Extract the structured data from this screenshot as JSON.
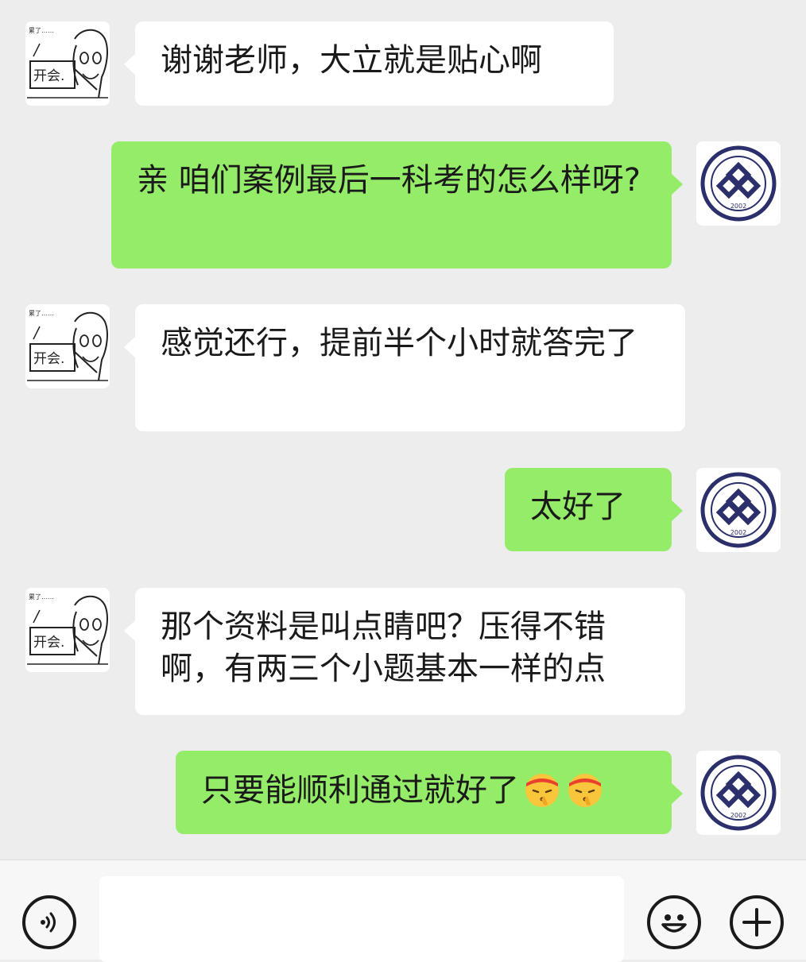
{
  "chat": {
    "messages": [
      {
        "sender": "contact",
        "text": "谢谢老师，大立就是贴心啊"
      },
      {
        "sender": "me",
        "text": "亲 咱们案例最后一科考的怎么样呀?"
      },
      {
        "sender": "contact",
        "text": "感觉还行，提前半个小时就答完了"
      },
      {
        "sender": "me",
        "text": "太好了"
      },
      {
        "sender": "contact",
        "text": "那个资料是叫点睛吧？压得不错啊，有两三个小题基本一样的点"
      },
      {
        "sender": "me",
        "text": "只要能顺利通过就好了",
        "emojis": [
          "shushing-face-headband-emoji",
          "shushing-face-headband-emoji"
        ]
      }
    ]
  },
  "contact_avatar": {
    "sticker_top": "累了……",
    "sticker_sign": "开会."
  },
  "my_avatar": {
    "year": "2002"
  },
  "input_bar": {
    "voice_icon": "voice-icon",
    "emoji_icon": "smiley-icon",
    "plus_icon": "plus-icon",
    "input_value": ""
  },
  "colors": {
    "background": "#ededed",
    "incoming_bubble": "#ffffff",
    "outgoing_bubble": "#95ec69",
    "logo": "#2b2f6b"
  }
}
